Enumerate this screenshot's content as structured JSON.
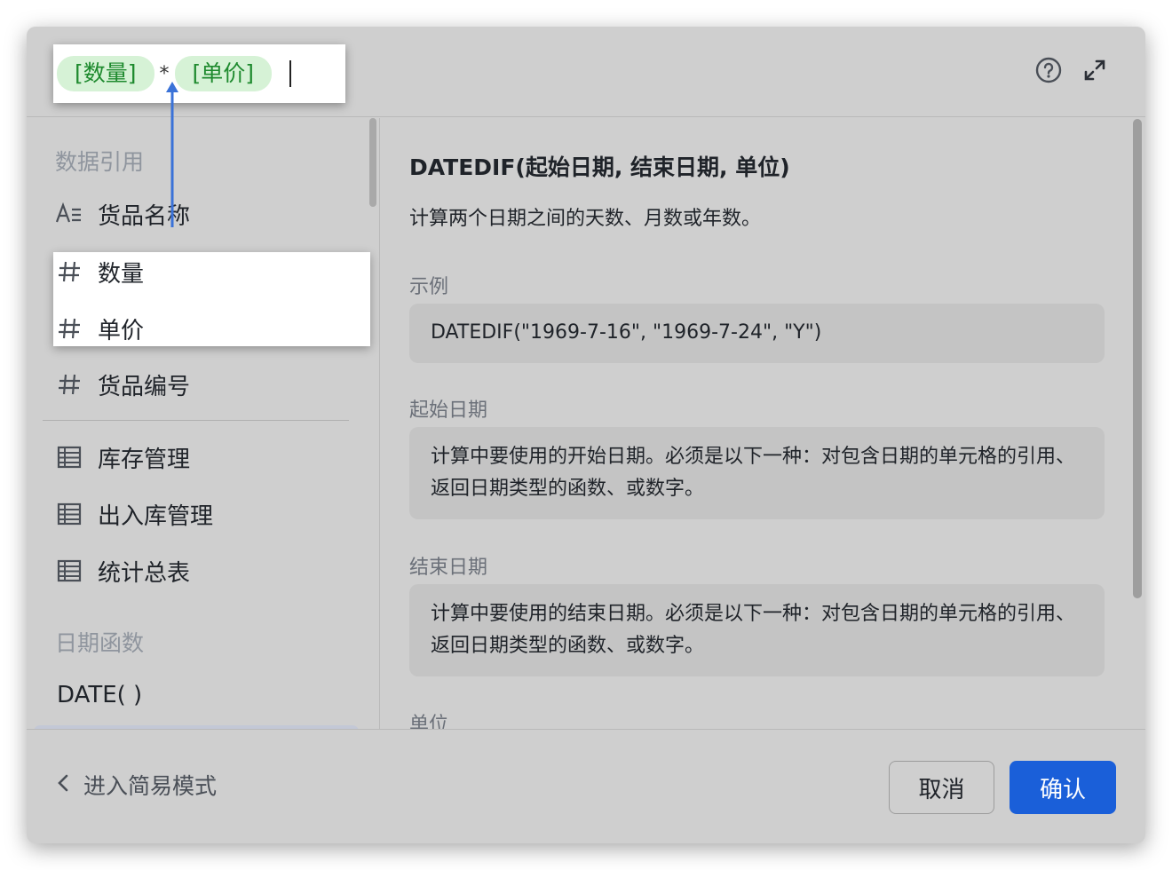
{
  "formula": {
    "chips": [
      "[数量]",
      "[单价]"
    ],
    "operator": "*"
  },
  "header_icons": [
    "help-circle-icon",
    "expand-icon"
  ],
  "sidebar": {
    "section_data_ref": "数据引用",
    "fields": [
      {
        "icon": "text-field-icon",
        "label": "货品名称"
      },
      {
        "icon": "number-field-icon",
        "label": "数量"
      },
      {
        "icon": "number-field-icon",
        "label": "单价"
      },
      {
        "icon": "number-field-icon",
        "label": "货品编号"
      }
    ],
    "tables": [
      {
        "icon": "table-icon",
        "label": "库存管理"
      },
      {
        "icon": "table-icon",
        "label": "出入库管理"
      },
      {
        "icon": "table-icon",
        "label": "统计总表"
      }
    ],
    "section_date_functions": "日期函数",
    "functions": [
      "DATE( )"
    ]
  },
  "content": {
    "title": "DATEDIF(起始日期, 结束日期, 单位)",
    "description": "计算两个日期之间的天数、月数或年数。",
    "example_label": "示例",
    "example": "DATEDIF(\"1969-7-16\", \"1969-7-24\", \"Y\")",
    "start_label": "起始日期",
    "start_desc": "计算中要使用的开始日期。必须是以下一种：对包含日期的单元格的引用、返回日期类型的函数、或数字。",
    "end_label": "结束日期",
    "end_desc": "计算中要使用的结束日期。必须是以下一种：对包含日期的单元格的引用、返回日期类型的函数、或数字。",
    "unit_label": "单位"
  },
  "footer": {
    "simple_mode": "进入简易模式",
    "cancel": "取消",
    "confirm": "确认"
  },
  "colors": {
    "chip_bg": "#d6f2d6",
    "chip_text": "#1e8a2e",
    "confirm_bg": "#1a5fd9",
    "arrow": "#3a72d8"
  }
}
